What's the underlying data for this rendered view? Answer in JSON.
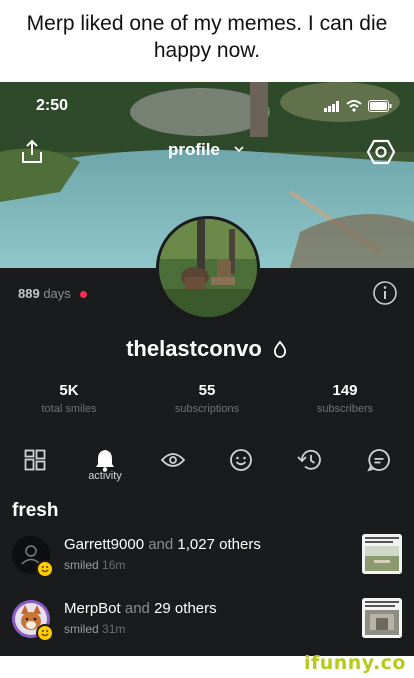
{
  "caption": "Merp liked one of my memes. I can die happy now.",
  "status_bar": {
    "time": "2:50"
  },
  "header": {
    "title": "profile"
  },
  "profile": {
    "days_count": "889",
    "days_label": "days",
    "username": "thelastconvo"
  },
  "stats": [
    {
      "value": "5K",
      "label": "total smiles"
    },
    {
      "value": "55",
      "label": "subscriptions"
    },
    {
      "value": "149",
      "label": "subscribers"
    }
  ],
  "tabs": [
    {
      "icon": "grid-icon",
      "label": ""
    },
    {
      "icon": "bell-icon",
      "label": "activity",
      "active": true
    },
    {
      "icon": "eye-icon",
      "label": ""
    },
    {
      "icon": "smile-icon",
      "label": ""
    },
    {
      "icon": "history-icon",
      "label": ""
    },
    {
      "icon": "comment-icon",
      "label": ""
    }
  ],
  "section": {
    "title": "fresh"
  },
  "feed": [
    {
      "user": "Garrett9000",
      "connector": "and",
      "others": "1,027 others",
      "action": "smiled",
      "time": "16m"
    },
    {
      "user": "MerpBot",
      "connector": "and",
      "others": "29 others",
      "action": "smiled",
      "time": "31m"
    }
  ],
  "watermark": "ifunny.co",
  "colors": {
    "background": "#1a1b1c",
    "notification_dot": "#ff2d55",
    "smile_badge": "#ffcc00",
    "watermark": "#b9c81f"
  }
}
